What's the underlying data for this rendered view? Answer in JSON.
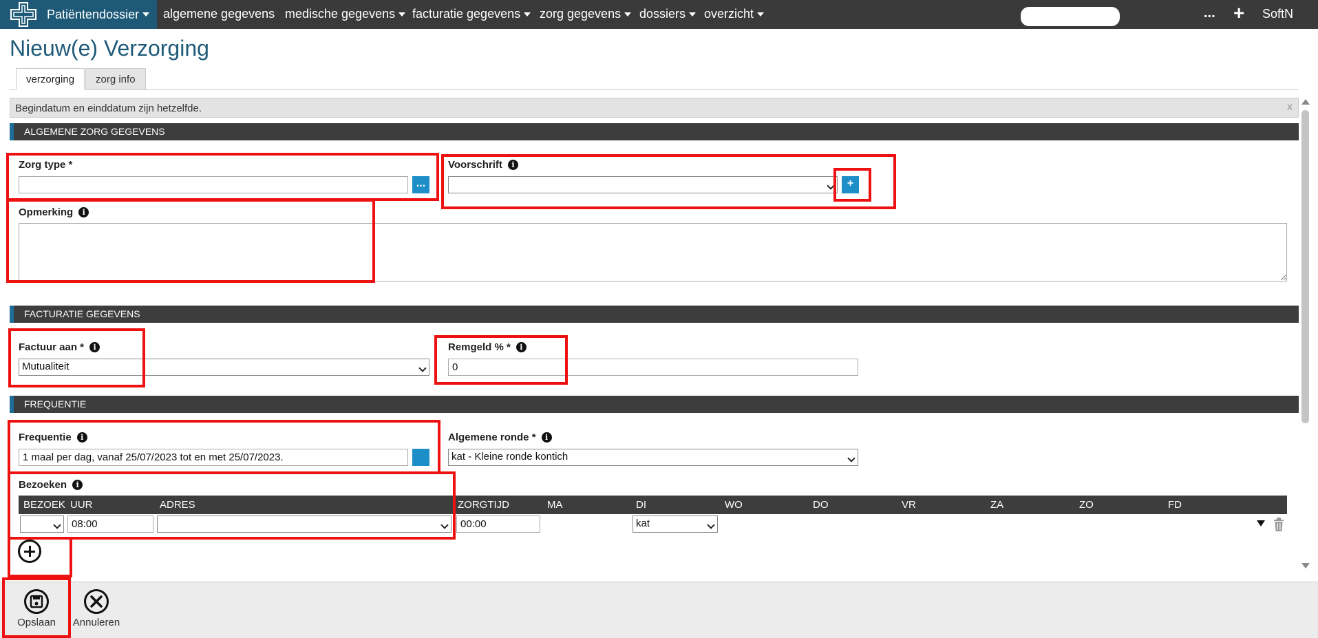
{
  "nav": {
    "brand": "Patiëntendossier",
    "items": [
      "algemene gegevens",
      "medische gegevens",
      "facturatie gegevens",
      "zorg gegevens",
      "dossiers",
      "overzicht"
    ],
    "more": "...",
    "plus": "+",
    "user": "SoftN"
  },
  "page": {
    "title": "Nieuw(e) Verzorging"
  },
  "tabs": [
    "verzorging",
    "zorg info"
  ],
  "info_message": "Begindatum en einddatum zijn hetzelfde.",
  "info_close": "x",
  "sections": {
    "algemeen": "ALGEMENE ZORG GEGEVENS",
    "facturatie": "FACTURATIE GEGEVENS",
    "frequentie": "FREQUENTIE"
  },
  "fields": {
    "zorg_type": {
      "label": "Zorg type *",
      "value": "",
      "button": "..."
    },
    "voorschrift": {
      "label": "Voorschrift",
      "value": "",
      "button": "+"
    },
    "opmerking": {
      "label": "Opmerking",
      "value": ""
    },
    "factuur_aan": {
      "label": "Factuur aan *",
      "value": "Mutualiteit"
    },
    "remgeld": {
      "label": "Remgeld % *",
      "value": "0"
    },
    "frequentie": {
      "label": "Frequentie",
      "value": "1 maal per dag, vanaf 25/07/2023 tot en met 25/07/2023."
    },
    "algemene_ronde": {
      "label": "Algemene ronde *",
      "value": "kat - Kleine ronde kontich"
    }
  },
  "bezoeken": {
    "label": "Bezoeken",
    "columns": [
      "BEZOEK",
      "UUR",
      "ADRES",
      "ZORGTIJD",
      "MA",
      "DI",
      "WO",
      "DO",
      "VR",
      "ZA",
      "ZO",
      "FD"
    ],
    "row": {
      "bezoek": "",
      "uur": "08:00",
      "adres": "",
      "zorgtijd": "00:00",
      "di": "kat"
    }
  },
  "footer": {
    "save": "Opslaan",
    "cancel": "Annuleren"
  },
  "colors": {
    "brand": "#1e5a78",
    "nav": "#3a3a3a",
    "accent": "#1e8ec9",
    "highlight": "#ee1111"
  },
  "icons": [
    "logo-icon",
    "info-icon",
    "plus-circle-icon",
    "trash-icon",
    "save-icon",
    "cancel-icon",
    "caret-down-icon"
  ]
}
